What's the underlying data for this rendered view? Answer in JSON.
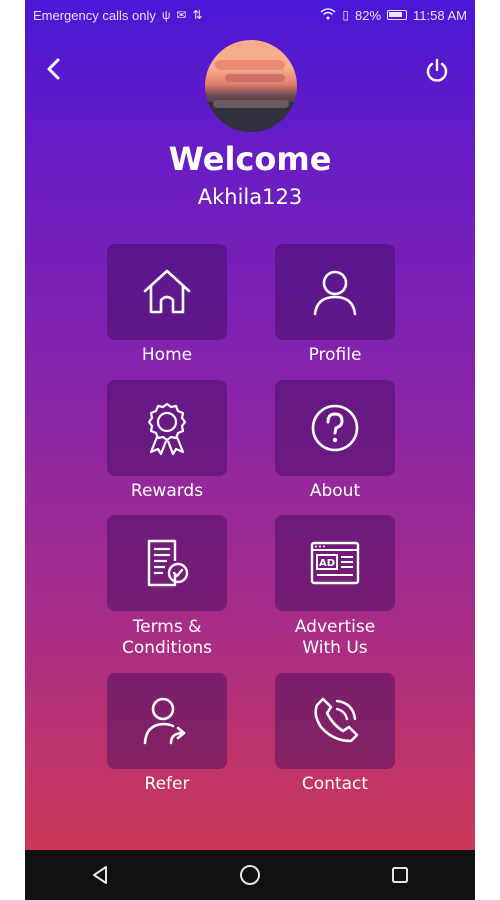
{
  "status_bar": {
    "carrier_text": "Emergency calls only",
    "battery_percent": "82%",
    "time": "11:58 AM"
  },
  "header": {
    "welcome": "Welcome",
    "username": "Akhila123"
  },
  "menu": [
    {
      "label": "Home",
      "icon": "home-icon"
    },
    {
      "label": "Profile",
      "icon": "user-icon"
    },
    {
      "label": "Rewards",
      "icon": "award-ribbon-icon"
    },
    {
      "label": "About",
      "icon": "question-circle-icon"
    },
    {
      "label": "Terms & Conditions",
      "icon": "document-check-icon"
    },
    {
      "label": "Advertise With Us",
      "icon": "ad-board-icon"
    },
    {
      "label": "Refer",
      "icon": "user-share-icon"
    },
    {
      "label": "Contact",
      "icon": "phone-icon"
    }
  ],
  "colors": {
    "gradient_top": "#4a17d6",
    "gradient_bottom": "#d53a50",
    "tile_bg": "rgba(60,10,90,0.45)",
    "nav_bar": "#111111"
  }
}
